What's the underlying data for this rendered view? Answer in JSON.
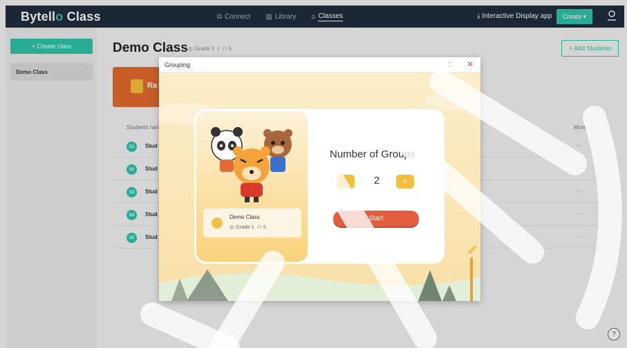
{
  "app": {
    "logo_main": "Bytell",
    "logo_o": "o",
    "logo_class": " Class"
  },
  "nav": [
    {
      "label": "Connect",
      "icon": "connect-icon"
    },
    {
      "label": "Library",
      "icon": "library-icon"
    },
    {
      "label": "Classes",
      "icon": "classes-icon",
      "active": true
    }
  ],
  "header": {
    "interactive_display": "Interactive Display app",
    "create_label": "Create"
  },
  "sidebar": {
    "create_class": "+ Create class",
    "classes": [
      {
        "name": "Demo Class"
      }
    ]
  },
  "main": {
    "title": "Demo Class",
    "grade": "Grade 1",
    "students_count": "5",
    "add_students": "+ Add Students",
    "banner_text": "Ra",
    "col_students": "Students nam",
    "col_more": "More",
    "students": [
      {
        "num": "S1",
        "name": "Stud"
      },
      {
        "num": "S2",
        "name": "Stud"
      },
      {
        "num": "S3",
        "name": "Stud"
      },
      {
        "num": "S4",
        "name": "Stud"
      },
      {
        "num": "S5",
        "name": "Stud"
      }
    ],
    "more_glyph": "···"
  },
  "modal": {
    "title": "Grouping",
    "class_name": "Demo Class",
    "grade": "Grade 1",
    "students_count": "5",
    "groups_title": "Number of Groups",
    "groups_value": "2",
    "minus": "−",
    "plus": "+",
    "start": "Start"
  },
  "colors": {
    "accent": "#2ec4a8",
    "topbar": "#1f2d3d",
    "start": "#e35d3f",
    "stepper": "#f2bf3a"
  }
}
